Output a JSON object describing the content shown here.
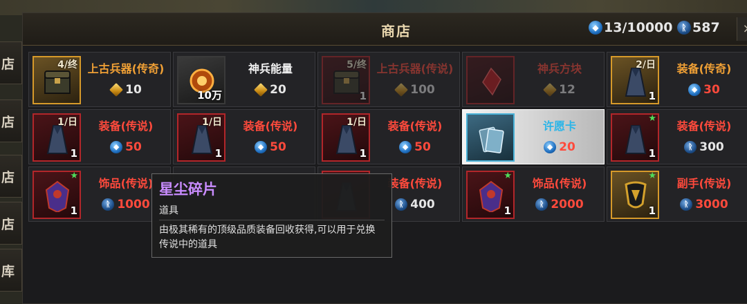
{
  "window": {
    "title": "商店"
  },
  "currency": [
    {
      "icon": "blue-crystal-icon",
      "value": "13/10000"
    },
    {
      "icon": "rune-coin-icon",
      "value": "587"
    }
  ],
  "side_tabs": [
    "店",
    "店",
    "店",
    "店",
    "库"
  ],
  "items": [
    {
      "name": "上古兵器(传奇)",
      "name_color": "orange",
      "limit": "4/终",
      "qty": "",
      "price": "10",
      "price_color": "light",
      "currency": "gold-shard-icon",
      "frame": "gold",
      "art": "chest-icon",
      "dim": false,
      "star": false
    },
    {
      "name": "神兵能量",
      "name_color": "white",
      "limit": "",
      "qty": "10万",
      "price": "20",
      "price_color": "light",
      "currency": "gold-shard-icon",
      "frame": "dark",
      "art": "energy-orb-icon",
      "dim": false,
      "star": false
    },
    {
      "name": "上古兵器(传说)",
      "name_color": "red",
      "limit": "5/终",
      "qty": "1",
      "price": "100",
      "price_color": "light",
      "currency": "gold-shard-icon",
      "frame": "red",
      "art": "chest-icon",
      "dim": true,
      "star": false
    },
    {
      "name": "神兵方块",
      "name_color": "red",
      "limit": "",
      "qty": "",
      "price": "12",
      "price_color": "light",
      "currency": "gold-shard-icon",
      "frame": "red",
      "art": "red-crystal-icon",
      "dim": true,
      "star": false
    },
    {
      "name": "装备(传奇)",
      "name_color": "orange",
      "limit": "2/日",
      "qty": "1",
      "price": "30",
      "price_color": "red",
      "currency": "blue-crystal-icon",
      "frame": "gold",
      "art": "robe-icon",
      "dim": false,
      "star": false
    },
    {
      "name": "装备(传说)",
      "name_color": "red",
      "limit": "1/日",
      "qty": "1",
      "price": "50",
      "price_color": "red",
      "currency": "blue-crystal-icon",
      "frame": "red",
      "art": "robe-icon",
      "dim": false,
      "star": false
    },
    {
      "name": "装备(传说)",
      "name_color": "red",
      "limit": "1/日",
      "qty": "1",
      "price": "50",
      "price_color": "red",
      "currency": "blue-crystal-icon",
      "frame": "red",
      "art": "robe-icon",
      "dim": false,
      "star": false
    },
    {
      "name": "装备(传说)",
      "name_color": "red",
      "limit": "1/日",
      "qty": "1",
      "price": "50",
      "price_color": "red",
      "currency": "blue-crystal-icon",
      "frame": "red",
      "art": "robe-icon",
      "dim": false,
      "star": false
    },
    {
      "name": "许愿卡",
      "name_color": "cyan",
      "limit": "",
      "qty": "",
      "price": "20",
      "price_color": "red",
      "currency": "blue-crystal-icon",
      "frame": "blue",
      "art": "wish-card-icon",
      "dim": false,
      "star": false,
      "selected": true
    },
    {
      "name": "装备(传说)",
      "name_color": "red",
      "limit": "",
      "qty": "1",
      "price": "300",
      "price_color": "light",
      "currency": "rune-coin-icon",
      "frame": "red",
      "art": "robe-icon",
      "dim": false,
      "star": true
    },
    {
      "name": "饰品(传说)",
      "name_color": "red",
      "limit": "",
      "qty": "1",
      "price": "1000",
      "price_color": "red",
      "currency": "rune-coin-icon",
      "frame": "red",
      "art": "amulet-icon",
      "dim": false,
      "star": true
    },
    {
      "name": "",
      "name_color": "red",
      "limit": "",
      "qty": "",
      "price": "",
      "price_color": "red",
      "currency": "",
      "frame": "red",
      "art": "",
      "dim": false,
      "star": false,
      "hidden": true
    },
    {
      "name": "装备(传说)",
      "name_color": "red",
      "limit": "",
      "qty": "",
      "price": "400",
      "price_color": "light",
      "currency": "rune-coin-icon",
      "frame": "red",
      "art": "robe-icon",
      "dim": false,
      "star": false
    },
    {
      "name": "饰品(传说)",
      "name_color": "red",
      "limit": "",
      "qty": "1",
      "price": "2000",
      "price_color": "red",
      "currency": "rune-coin-icon",
      "frame": "red",
      "art": "amulet-icon",
      "dim": false,
      "star": true
    },
    {
      "name": "副手(传说)",
      "name_color": "red",
      "limit": "",
      "qty": "1",
      "price": "3000",
      "price_color": "red",
      "currency": "rune-coin-icon",
      "frame": "gold",
      "art": "shield-icon",
      "dim": false,
      "star": true
    }
  ],
  "tooltip": {
    "title": "星尘碎片",
    "type": "道具",
    "description": "由极其稀有的顶级品质装备回收获得,可以用于兑换传说中的道具"
  }
}
